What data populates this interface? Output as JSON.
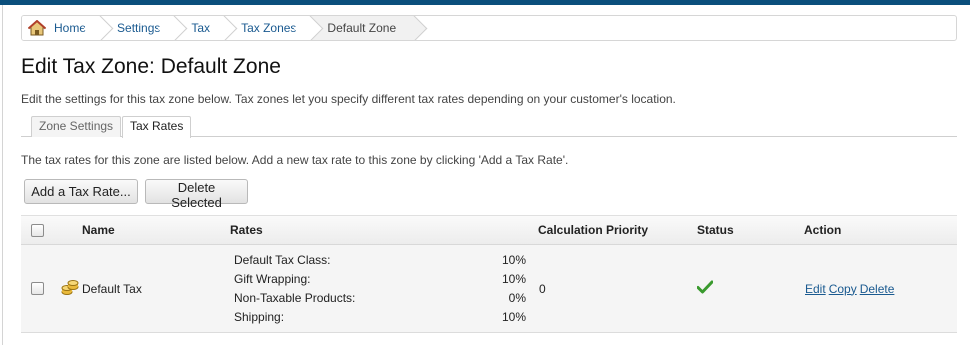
{
  "breadcrumb": {
    "items": [
      {
        "label": "Home"
      },
      {
        "label": "Settings"
      },
      {
        "label": "Tax"
      },
      {
        "label": "Tax Zones"
      },
      {
        "label": "Default Zone"
      }
    ]
  },
  "page": {
    "title": "Edit Tax Zone: Default Zone",
    "intro": "Edit the settings for this tax zone below. Tax zones let you specify different tax rates depending on your customer's location."
  },
  "tabs": [
    {
      "label": "Zone Settings",
      "active": false
    },
    {
      "label": "Tax Rates",
      "active": true
    }
  ],
  "rates_section": {
    "description": "The tax rates for this zone are listed below. Add a new tax rate to this zone by clicking 'Add a Tax Rate'.",
    "add_button": "Add a Tax Rate...",
    "delete_button": "Delete Selected"
  },
  "table": {
    "headers": {
      "name": "Name",
      "rates": "Rates",
      "priority": "Calculation Priority",
      "status": "Status",
      "action": "Action"
    },
    "rows": [
      {
        "name": "Default Tax",
        "rates": [
          {
            "label": "Default Tax Class:",
            "value": "10%"
          },
          {
            "label": "Gift Wrapping:",
            "value": "10%"
          },
          {
            "label": "Non-Taxable Products:",
            "value": "0%"
          },
          {
            "label": "Shipping:",
            "value": "10%"
          }
        ],
        "priority": "0",
        "status_icon": "checkmark-icon",
        "actions": {
          "edit": "Edit",
          "copy": "Copy",
          "delete": "Delete"
        }
      }
    ]
  },
  "colors": {
    "top_bar": "#0b4f7c",
    "link": "#1a5a90",
    "status_ok": "#3a9a2e"
  }
}
